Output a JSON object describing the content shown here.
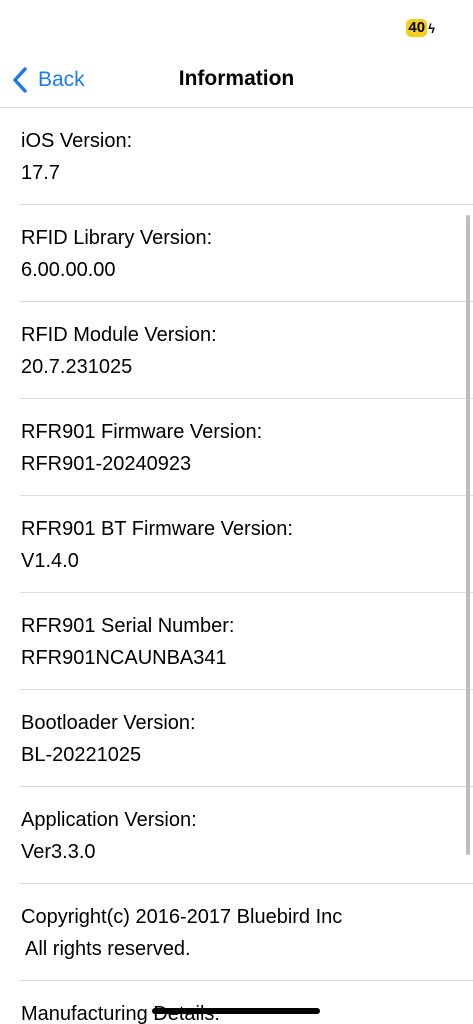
{
  "status_bar": {
    "battery_level": "40",
    "battery_color": "#f5cf1d",
    "charging_icon": "bolt-icon"
  },
  "nav": {
    "back_label": "Back",
    "back_icon": "chevron-left-icon",
    "title": "Information",
    "accent_color": "#1a7cf5"
  },
  "info_items": [
    {
      "label": "iOS Version:",
      "value": "17.7"
    },
    {
      "label": "RFID Library Version:",
      "value": "6.00.00.00"
    },
    {
      "label": "RFID Module Version:",
      "value": "20.7.231025"
    },
    {
      "label": "RFR901 Firmware Version:",
      "value": "RFR901-20240923"
    },
    {
      "label": "RFR901 BT Firmware Version:",
      "value": "V1.4.0"
    },
    {
      "label": "RFR901 Serial Number:",
      "value": "RFR901NCAUNBA341"
    },
    {
      "label": "Bootloader Version:",
      "value": "BL-20221025"
    },
    {
      "label": "Application Version:",
      "value": "Ver3.3.0"
    }
  ],
  "copyright": {
    "line1": "Copyright(c) 2016-2017 Bluebird Inc",
    "line2": "All rights reserved."
  },
  "manufacturing": {
    "label": "Manufacturing Details:"
  }
}
